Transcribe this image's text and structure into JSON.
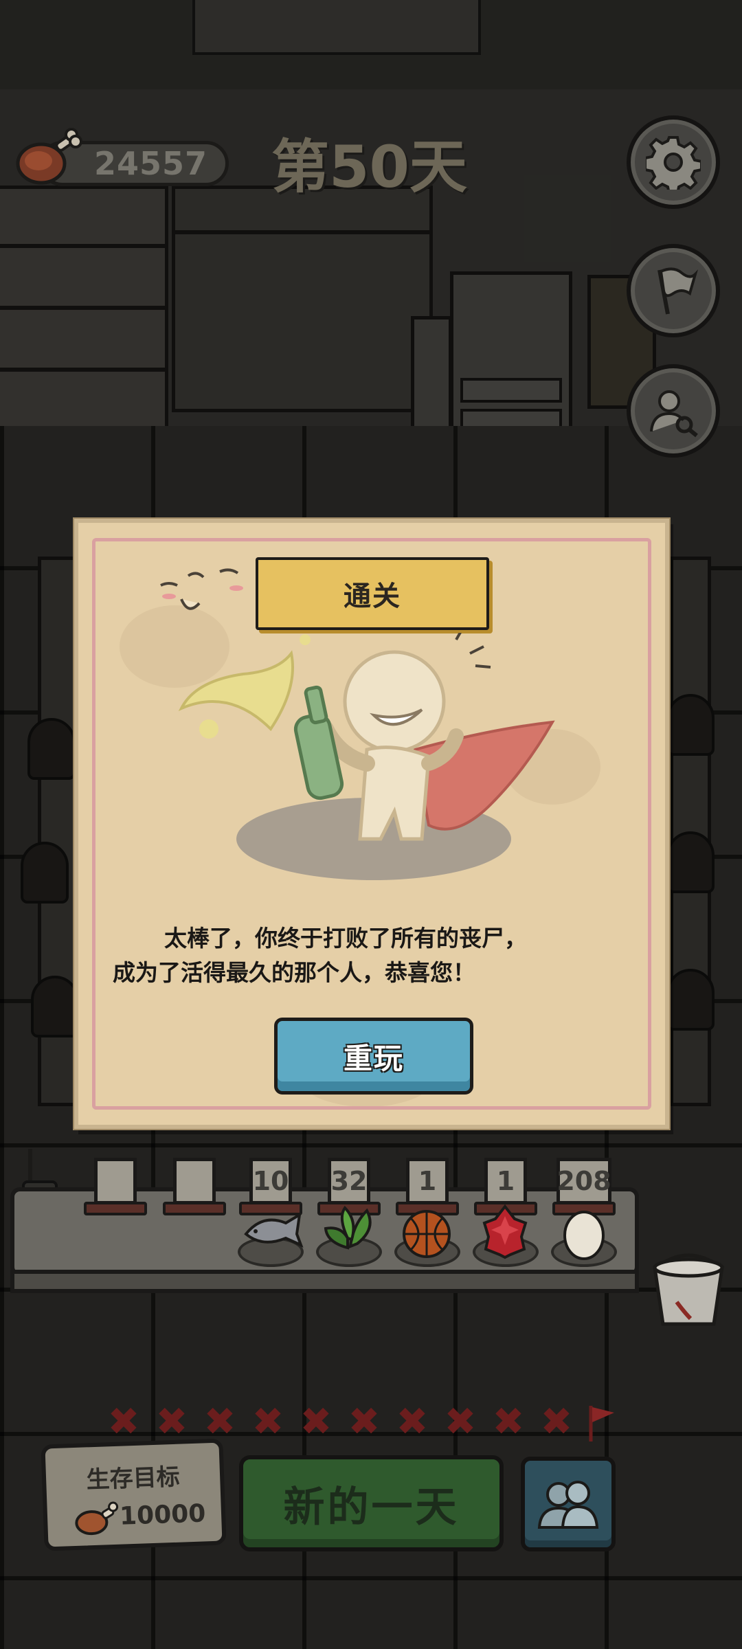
{
  "hud": {
    "coins": "24557",
    "day_title": "第50天"
  },
  "modal": {
    "title": "通关",
    "message_line1": "太棒了，你终于打败了所有的丧尸，",
    "message_line2": "成为了活得最久的那个人，恭喜您！",
    "replay_label": "重玩"
  },
  "inventory": {
    "slots": [
      {
        "count": "",
        "icon": "empty-slot"
      },
      {
        "count": "",
        "icon": "empty-slot"
      },
      {
        "count": "10",
        "icon": "fish-icon"
      },
      {
        "count": "32",
        "icon": "herb-leaf-icon"
      },
      {
        "count": "1",
        "icon": "basketball-icon"
      },
      {
        "count": "1",
        "icon": "dragonfruit-icon"
      },
      {
        "count": "208",
        "icon": "egg-icon"
      }
    ]
  },
  "goal": {
    "label": "生存目标",
    "value": "10000"
  },
  "strikes": {
    "count": 10,
    "mark": "✖"
  },
  "actions": {
    "new_day_label": "新的一天"
  },
  "colors": {
    "accent_green": "#2f5a2d",
    "replay_blue": "#5eaac4",
    "banner_yellow": "#e6c160",
    "strike_red": "#6b1d1d"
  }
}
